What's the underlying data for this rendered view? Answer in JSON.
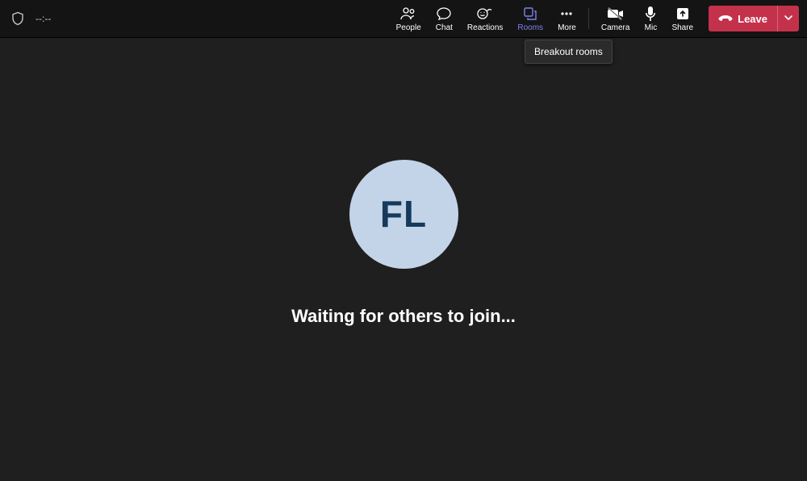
{
  "header": {
    "timer": "--:--",
    "tooltip": "Breakout rooms"
  },
  "tools": {
    "people": "People",
    "chat": "Chat",
    "reactions": "Reactions",
    "rooms": "Rooms",
    "more": "More",
    "camera": "Camera",
    "mic": "Mic",
    "share": "Share"
  },
  "leave": {
    "label": "Leave"
  },
  "main": {
    "avatar_initials": "FL",
    "waiting_text": "Waiting for others to join..."
  },
  "colors": {
    "accent": "#7b83eb",
    "leave": "#c4314b",
    "avatar_bg": "#c4d4e8",
    "avatar_fg": "#153a5b"
  }
}
